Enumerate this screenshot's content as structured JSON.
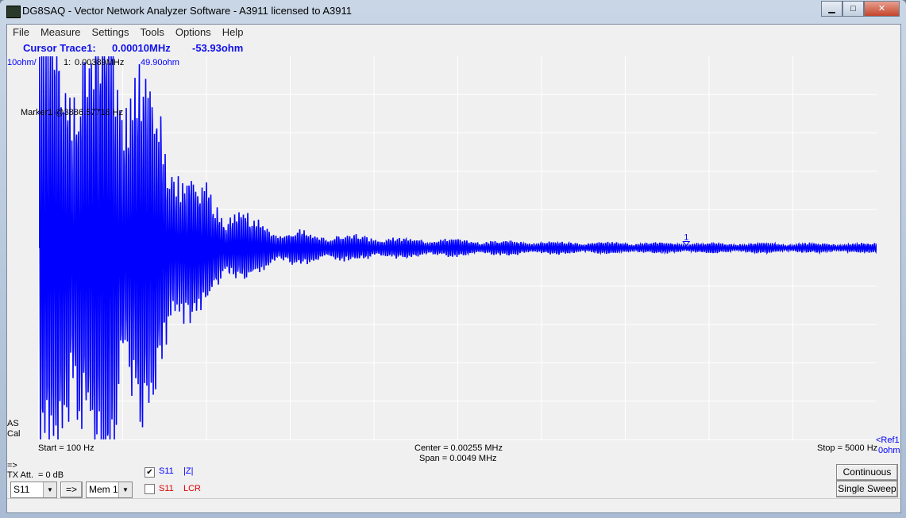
{
  "window": {
    "title": "DG8SAQ  -  Vector Network Analyzer Software  - A3911 licensed to A3911",
    "min": "▁",
    "max": "□",
    "close": "✕"
  },
  "menu": [
    "File",
    "Measure",
    "Settings",
    "Tools",
    "Options",
    "Help"
  ],
  "cursor": {
    "label": "Cursor Trace1:",
    "freq": "0.00010MHz",
    "value": "-53.93ohm"
  },
  "plot": {
    "scale": "10ohm/",
    "marker_index": "1:",
    "marker_freq": "0.00389MHz",
    "marker_value": "49.90ohm",
    "marker_text": "Marker1 @3886.57718 Hz",
    "marker_flag": "1",
    "as": "AS",
    "cal": "Cal",
    "start": "Start = 100 Hz",
    "center": "Center = 0.00255 MHz",
    "span": "Span = 0.0049 MHz",
    "stop": "Stop = 5000 Hz",
    "ref": "<Ref1",
    "ref_value": "0ohm",
    "trace_color": "#0000ff",
    "background": "#f0f0f0",
    "grid_color": "#ffffff"
  },
  "chart_data": {
    "type": "line",
    "xlabel": "",
    "ylabel": "",
    "x_unit": "Hz",
    "y_unit": "ohm",
    "xlim": [
      100,
      5000
    ],
    "ylim": [
      -50,
      50
    ],
    "grid": true,
    "series": [
      {
        "label": "S11 |Z|",
        "envelope": {
          "x": [
            100,
            300,
            500,
            700,
            900,
            1100,
            1300,
            1500,
            1800,
            2200,
            2600,
            3000,
            3500,
            4000,
            4500,
            5000
          ],
          "amplitude": [
            50,
            50,
            50,
            40,
            22,
            12,
            7,
            4,
            3,
            2.2,
            1.8,
            1.4,
            1.2,
            1.1,
            1,
            1
          ]
        }
      }
    ],
    "marker": {
      "x": 3886.57718,
      "y": 49.9
    }
  },
  "controls": {
    "arrow": "=>",
    "tx_att_label": "TX Att.",
    "tx_att_value": "= 0 dB",
    "port_select": "S11",
    "transfer": "=>",
    "mem_select": "Mem 1",
    "traces": [
      {
        "checked": true,
        "param": "S11",
        "format": "|Z|"
      },
      {
        "checked": false,
        "param": "S11",
        "format": "LCR"
      }
    ],
    "continuous": "Continuous",
    "single_sweep": "Single Sweep"
  }
}
